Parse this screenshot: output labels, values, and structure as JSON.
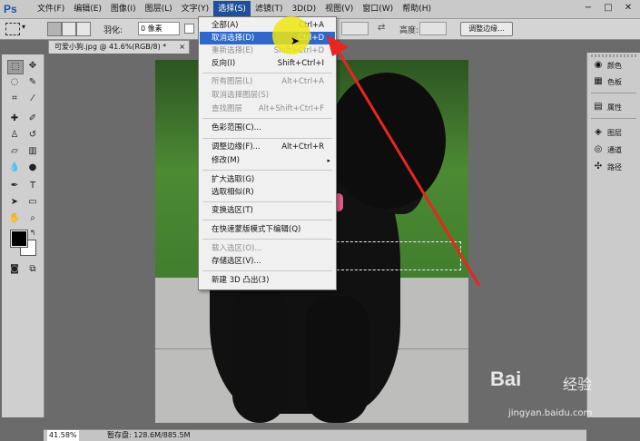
{
  "app": {
    "logo": "Ps"
  },
  "menubar": {
    "items": [
      "文件(F)",
      "编辑(E)",
      "图像(I)",
      "图层(L)",
      "文字(Y)",
      "选择(S)",
      "滤镜(T)",
      "3D(D)",
      "视图(V)",
      "窗口(W)",
      "帮助(H)"
    ],
    "active_index": 5
  },
  "window_controls": {
    "minimize": "−",
    "restore": "□",
    "close": "✕"
  },
  "options_bar": {
    "feather_label": "羽化:",
    "feather_value": "0 像素",
    "height_label": "高度:",
    "refine_edge": "调整边缘..."
  },
  "document": {
    "tab_title": "可爱小狗.jpg @ 41.6%(RGB/8) *",
    "tab_close": "×"
  },
  "dropdown": {
    "items": [
      {
        "label": "全部(A)",
        "shortcut": "Ctrl+A",
        "state": "normal"
      },
      {
        "label": "取消选择(D)",
        "shortcut": "Ctrl+D",
        "state": "highlight"
      },
      {
        "label": "重新选择(E)",
        "shortcut": "Shift+Ctrl+D",
        "state": "disabled"
      },
      {
        "label": "反向(I)",
        "shortcut": "Shift+Ctrl+I",
        "state": "normal"
      },
      {
        "label": "所有图层(L)",
        "shortcut": "Alt+Ctrl+A",
        "state": "disabled"
      },
      {
        "label": "取消选择图层(S)",
        "shortcut": "",
        "state": "disabled"
      },
      {
        "label": "查找图层",
        "shortcut": "Alt+Shift+Ctrl+F",
        "state": "disabled"
      },
      {
        "label": "色彩范围(C)...",
        "shortcut": "",
        "state": "normal"
      },
      {
        "label": "调整边缘(F)...",
        "shortcut": "Alt+Ctrl+R",
        "state": "normal"
      },
      {
        "label": "修改(M)",
        "shortcut": "",
        "state": "normal",
        "submenu": "▸"
      },
      {
        "label": "扩大选取(G)",
        "shortcut": "",
        "state": "normal"
      },
      {
        "label": "选取相似(R)",
        "shortcut": "",
        "state": "normal"
      },
      {
        "label": "变换选区(T)",
        "shortcut": "",
        "state": "normal"
      },
      {
        "label": "在快速蒙版模式下编辑(Q)",
        "shortcut": "",
        "state": "normal"
      },
      {
        "label": "载入选区(O)...",
        "shortcut": "",
        "state": "disabled"
      },
      {
        "label": "存储选区(V)...",
        "shortcut": "",
        "state": "normal"
      },
      {
        "label": "新建 3D 凸出(3)",
        "shortcut": "",
        "state": "normal"
      }
    ]
  },
  "panels": {
    "items": [
      {
        "icon": "palette-icon",
        "glyph": "◉",
        "label": "颜色"
      },
      {
        "icon": "swatches-icon",
        "glyph": "▦",
        "label": "色板"
      },
      {
        "icon": "properties-icon",
        "glyph": "▤",
        "label": "属性"
      },
      {
        "icon": "layers-icon",
        "glyph": "◈",
        "label": "图层"
      },
      {
        "icon": "channels-icon",
        "glyph": "◎",
        "label": "通道"
      },
      {
        "icon": "paths-icon",
        "glyph": "✣",
        "label": "路径"
      }
    ]
  },
  "status": {
    "zoom": "41.58%",
    "doc_info": "暂存盘: 128.6M/885.5M"
  },
  "watermark": {
    "logo": "Bai",
    "cn": "经验",
    "url": "jingyan.baidu.com"
  },
  "colors": {
    "menu_highlight": "#2f68c8",
    "arrow": "#e8261f",
    "cursor_highlight": "#eee614"
  }
}
